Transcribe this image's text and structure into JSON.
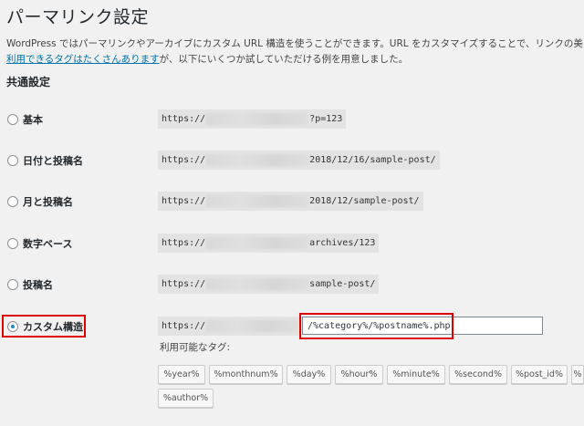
{
  "page": {
    "title": "パーマリンク設定",
    "intro_line1": "WordPress ではパーマリンクやアーカイブにカスタム URL 構造を使うことができます。URL をカスタマイズすることで、リンクの美しさや使い",
    "intro_link": "利用できるタグはたくさんあります",
    "intro_line2_rest": "が、以下にいくつか試していただける例を用意しました。"
  },
  "section": {
    "title": "共通設定"
  },
  "options": [
    {
      "label": "基本",
      "prefix": "https://",
      "suffix": "?p=123",
      "checked": false
    },
    {
      "label": "日付と投稿名",
      "prefix": "https://",
      "suffix": "2018/12/16/sample-post/",
      "checked": false
    },
    {
      "label": "月と投稿名",
      "prefix": "https://",
      "suffix": "2018/12/sample-post/",
      "checked": false
    },
    {
      "label": "数字ベース",
      "prefix": "https://",
      "suffix": "archives/123",
      "checked": false
    },
    {
      "label": "投稿名",
      "prefix": "https://",
      "suffix": "sample-post/",
      "checked": false
    },
    {
      "label": "カスタム構造",
      "prefix": "https://",
      "suffix": "",
      "checked": true
    }
  ],
  "custom": {
    "value": "/%category%/%postname%.php"
  },
  "tags": {
    "label": "利用可能なタグ:",
    "items": [
      "%year%",
      "%monthnum%",
      "%day%",
      "%hour%",
      "%minute%",
      "%second%",
      "%post_id%",
      "%",
      "%author%"
    ]
  },
  "colors": {
    "highlight": "#e00000",
    "link": "#0073aa",
    "radio_checked": "#1e8cbe"
  }
}
